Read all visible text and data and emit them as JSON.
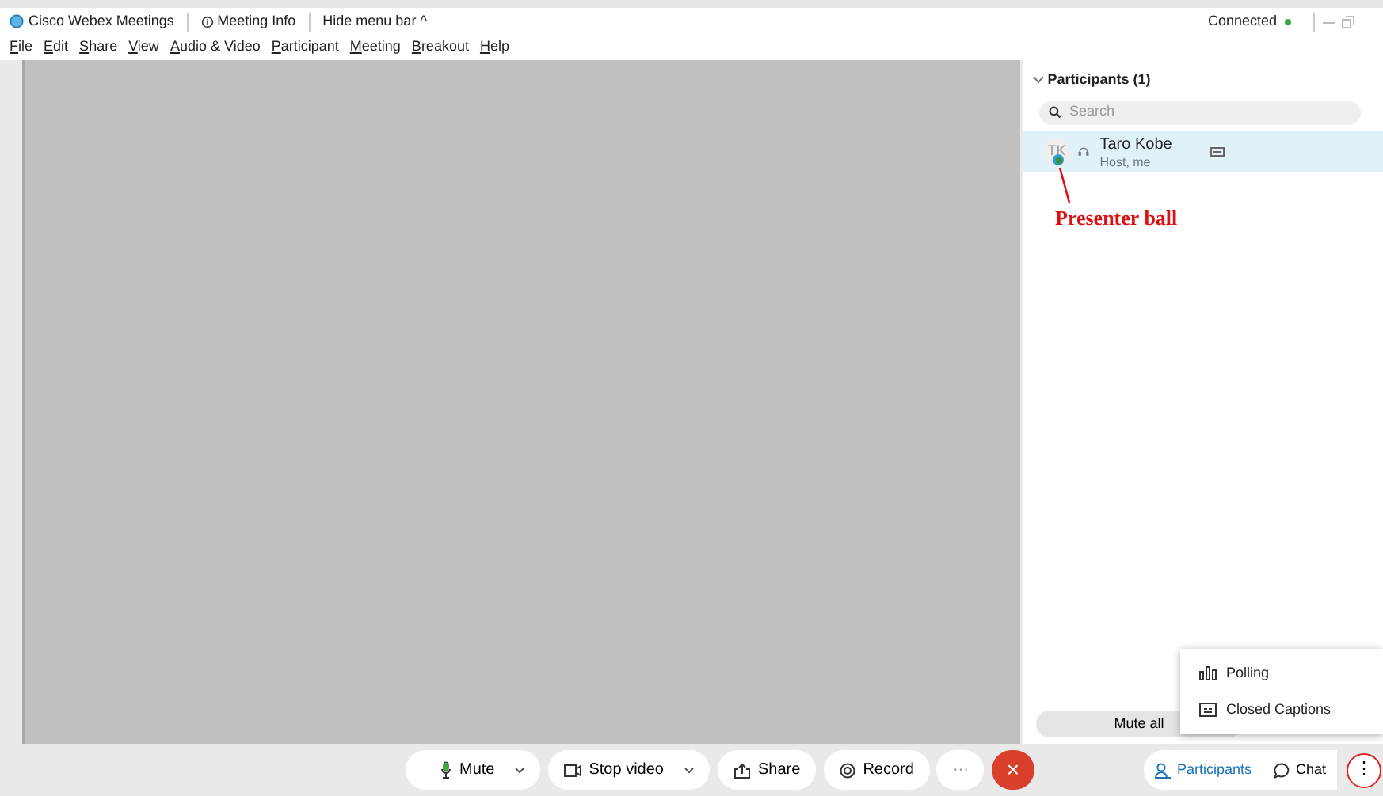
{
  "title_bar": {
    "app_name": "Cisco Webex Meetings",
    "meeting_info": "Meeting Info",
    "hide_menu": "Hide menu bar ^",
    "status": "Connected"
  },
  "menu_bar": [
    "File",
    "Edit",
    "Share",
    "View",
    "Audio & Video",
    "Participant",
    "Meeting",
    "Breakout",
    "Help"
  ],
  "participants_panel": {
    "title": "Participants (1)",
    "expanded": true,
    "search": {
      "placeholder": "Search"
    },
    "participants": [
      {
        "initials": "TK",
        "name": "Taro Kobe",
        "role": "Host, me",
        "selected": true,
        "presenter": true
      }
    ],
    "mute_all": "Mute all"
  },
  "annotation": {
    "label": "Presenter ball"
  },
  "more_menu": [
    {
      "kind": "polling",
      "label": "Polling"
    },
    {
      "kind": "captions",
      "label": "Closed Captions"
    }
  ],
  "controls": [
    {
      "kind": "mute",
      "label": "Mute",
      "dropdown": true
    },
    {
      "kind": "video",
      "label": "Stop video",
      "dropdown": true
    },
    {
      "kind": "share",
      "label": "Share",
      "dropdown": false
    },
    {
      "kind": "record",
      "label": "Record",
      "dropdown": false
    },
    {
      "kind": "more",
      "label": "···",
      "dropdown": false
    },
    {
      "kind": "end",
      "label": "×",
      "dropdown": false
    }
  ],
  "panel_buttons": [
    {
      "kind": "participants",
      "label": "Participants",
      "selected": true
    },
    {
      "kind": "chat",
      "label": "Chat",
      "selected": false
    },
    {
      "kind": "more",
      "label": "⋮",
      "selected": false,
      "highlighted": true
    }
  ]
}
